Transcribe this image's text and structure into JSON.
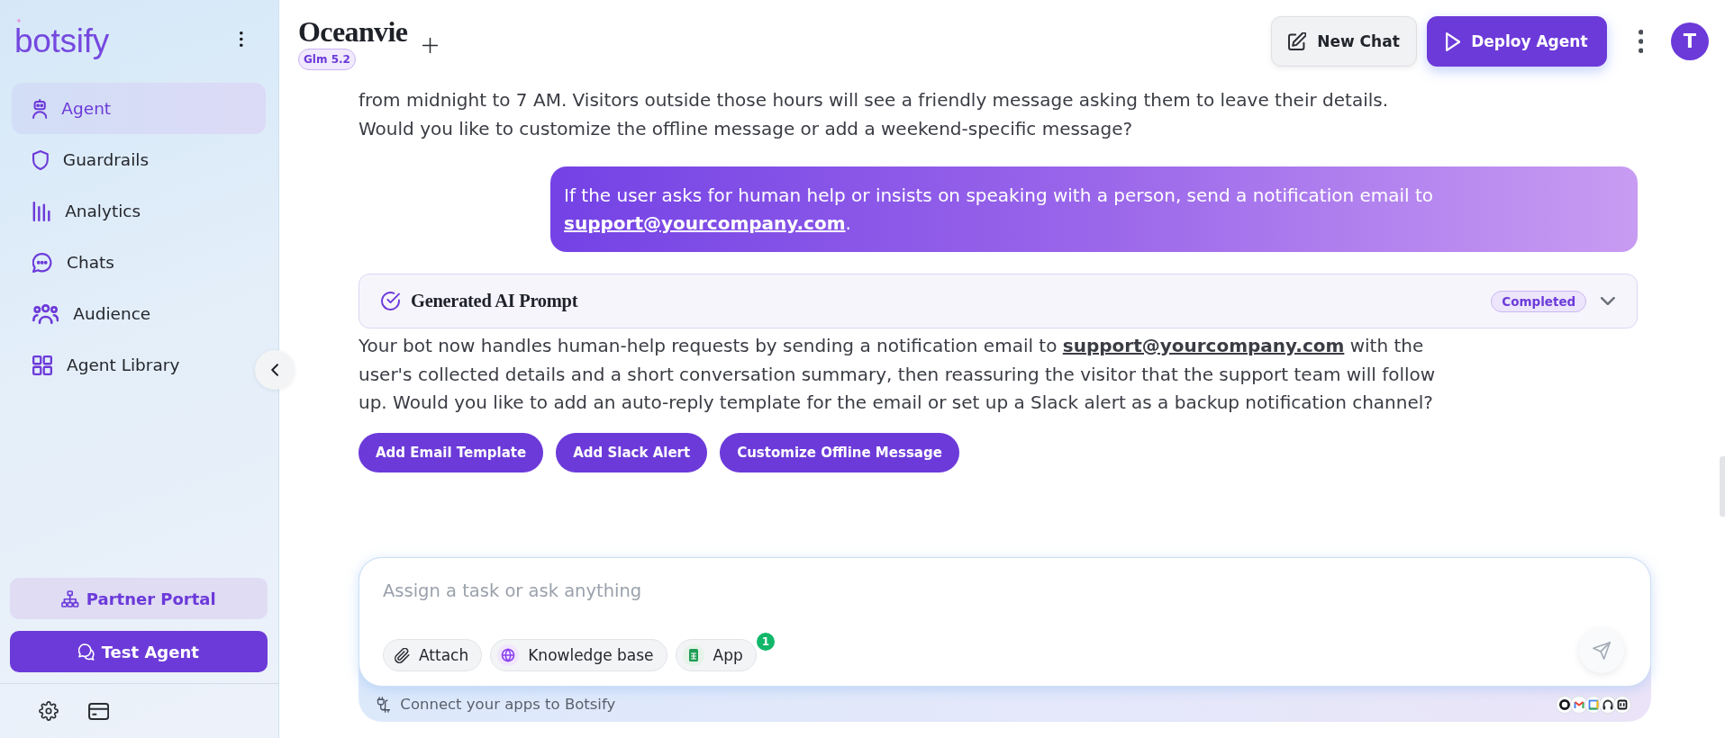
{
  "sidebar": {
    "logo": "botsify",
    "nav_items": [
      {
        "label": "Agent",
        "selected": true
      },
      {
        "label": "Guardrails",
        "selected": false
      },
      {
        "label": "Analytics",
        "selected": false
      },
      {
        "label": "Chats",
        "selected": false
      },
      {
        "label": "Audience",
        "selected": false
      },
      {
        "label": "Agent Library",
        "selected": false
      }
    ],
    "buttons": [
      {
        "label": "Partner Portal",
        "kind": "secondary"
      },
      {
        "label": "Test Agent",
        "kind": "primary"
      }
    ]
  },
  "header": {
    "title": "Oceanvie",
    "model_badge": "Glm 5.2",
    "buttons": [
      {
        "label": "New Chat",
        "kind": "secondary"
      },
      {
        "label": "Deploy Agent",
        "kind": "primary"
      }
    ],
    "avatar": "T"
  },
  "messages": [
    {
      "kind": "assistant",
      "parts": [
        {
          "text": "from midnight to 7 AM. Visitors outside those hours will see a friendly message asking them to leave their details. Would you like to customize the offline message or add a weekend-specific message?"
        }
      ]
    },
    {
      "kind": "user",
      "parts": [
        {
          "text": "If the user asks for human help or insists on speaking with a person, send a notification email to "
        },
        {
          "link": "support@yourcompany.com"
        },
        {
          "text": "."
        }
      ]
    },
    {
      "kind": "prompt_card",
      "title": "Generated AI Prompt",
      "status": "Completed",
      "expanded": false
    },
    {
      "kind": "assistant",
      "parts": [
        {
          "text": "Your bot now handles human-help requests by sending a notification email to "
        },
        {
          "link": "support@yourcompany.com"
        },
        {
          "text": " with the user's collected details and a short conversation summary, then reassuring the visitor that the support team will follow up. Would you like to add an auto-reply template for the email or set up a Slack alert as a backup notification channel?"
        }
      ]
    }
  ],
  "suggestions": [
    {
      "label": "Add Email Template"
    },
    {
      "label": "Add Slack Alert"
    },
    {
      "label": "Customize Offline Message"
    }
  ],
  "composer": {
    "placeholder": "Assign a task or ask anything",
    "chips": [
      {
        "label": "Attach"
      },
      {
        "label": "Knowledge base"
      },
      {
        "label": "App",
        "badge": "1"
      }
    ],
    "footer": "Connect your apps to Botsify"
  }
}
